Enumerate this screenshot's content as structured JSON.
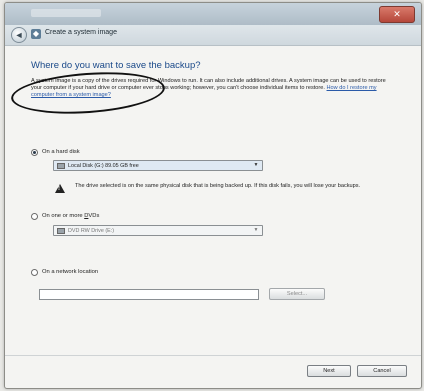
{
  "window": {
    "nav_title": "Create a system image",
    "back_glyph": "◄",
    "close_glyph": "✕"
  },
  "main": {
    "heading": "Where do you want to save the backup?",
    "description": "A system image is a copy of the drives required for Windows to run. It can also include additional drives. A system image can be used to restore your computer if your hard drive or computer ever stops working; however, you can't choose individual items to restore.",
    "description_link": "How do I restore my computer from a system image?"
  },
  "options": {
    "hard_disk": {
      "label": "On a hard disk",
      "selected": true,
      "dropdown_value": "Local Disk (G:) 89.05 GB free",
      "warning": "The drive selected is on the same physical disk that is being backed up. If this disk fails, you will lose your backups."
    },
    "dvd": {
      "label_prefix": "On one or more ",
      "label_key": "D",
      "label_suffix": "VDs",
      "selected": false,
      "dropdown_value": "DVD RW Drive (E:)"
    },
    "network": {
      "label": "On a network location",
      "selected": false,
      "input_value": "",
      "select_label": "Select..."
    }
  },
  "footer": {
    "next_label": "Next",
    "cancel_label": "Cancel"
  },
  "icons": {
    "warning": "warning-icon",
    "drive": "drive-icon",
    "dvd": "dvd-drive-icon"
  }
}
